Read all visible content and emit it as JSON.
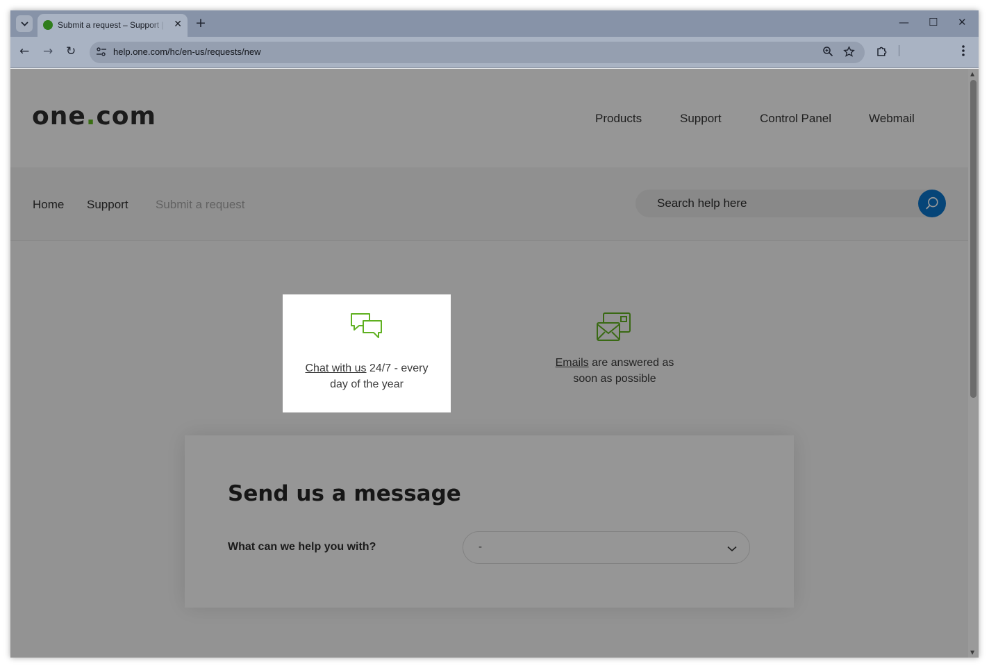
{
  "browser": {
    "tab_title": "Submit a request – Support | one.com",
    "tab_close": "✕",
    "new_tab": "+",
    "tab_dropdown": "⌄",
    "url": "help.one.com/hc/en-us/requests/new",
    "window_controls": {
      "minimize": "—",
      "maximize": "☐",
      "close": "✕"
    },
    "nav": {
      "back": "←",
      "forward": "→",
      "reload": "↻"
    }
  },
  "site": {
    "logo_text_a": "one",
    "logo_dot": ".",
    "logo_text_b": "com",
    "topnav": [
      "Products",
      "Support",
      "Control Panel",
      "Webmail"
    ],
    "breadcrumb": [
      "Home",
      "Support",
      "Submit a request"
    ],
    "search_placeholder": "Search help here"
  },
  "contact": {
    "chat": {
      "link": "Chat with us",
      "text_a": " 24/7 - every",
      "text_b": "day of the year"
    },
    "email": {
      "link": "Emails",
      "text_a": " are answered as",
      "text_b": "soon as possible"
    }
  },
  "form": {
    "title": "Send us a message",
    "help_label": "What can we help you with?",
    "help_value": "-"
  },
  "colors": {
    "brand_green": "#60b720",
    "search_blue": "#0b73c9",
    "icon_green": "#5fb020"
  }
}
